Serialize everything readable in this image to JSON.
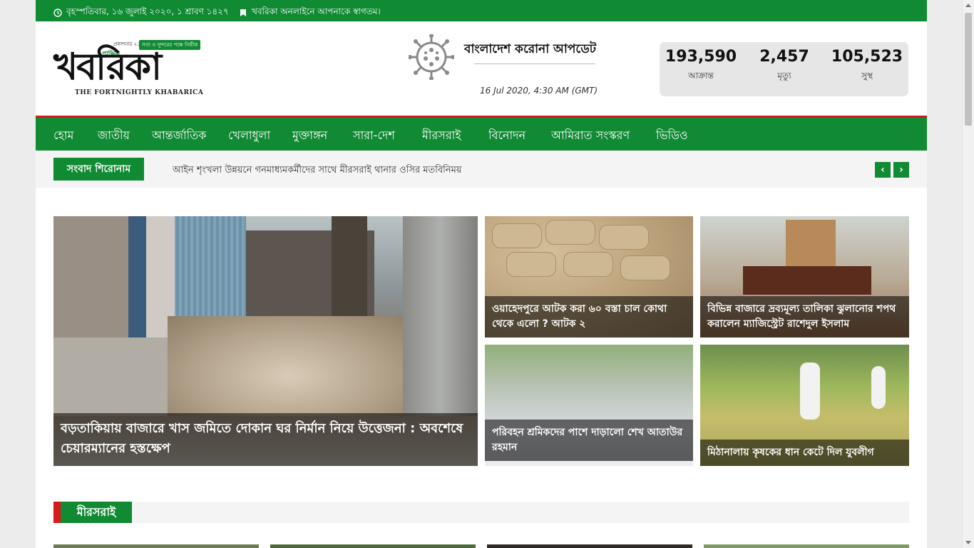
{
  "topbar": {
    "date": "বৃহস্পতিবার, ১৬ জুলাই ২০২০, ১ শ্রাবণ ১৪২৭",
    "welcome": "খবরিকা অনলাইনে আপনাকে স্বাগতম।"
  },
  "logo": {
    "brand": "খবরিকা",
    "paksik": "পাক্ষিক",
    "year": "প্রকাশনার ২১ বছর",
    "tagline": "সত্য ও সুন্দরের পক্ষে নির্ভীক",
    "english": "THE FORTNIGHTLY KHABARICA"
  },
  "corona": {
    "title": "বাংলাদেশ করোনা আপডেট",
    "date": "16 Jul 2020, 4:30 AM (GMT)"
  },
  "stats": [
    {
      "value": "193,590",
      "label": "আক্রান্ত"
    },
    {
      "value": "2,457",
      "label": "মৃত্যু"
    },
    {
      "value": "105,523",
      "label": "সুস্থ"
    }
  ],
  "nav": [
    {
      "label": "হোম",
      "active": true
    },
    {
      "label": "জাতীয়"
    },
    {
      "label": "আন্তর্জাতিক"
    },
    {
      "label": "খেলাধুলা"
    },
    {
      "label": "মুক্তাঙ্গন"
    },
    {
      "label": "সারা-দেশ"
    },
    {
      "label": "মীরসরাই"
    },
    {
      "label": "বিনোদন"
    },
    {
      "label": "আমিরাত সংস্করণ"
    },
    {
      "label": "ভিডিও"
    }
  ],
  "ticker": {
    "label": "সংবাদ শিরোনাম",
    "headline": "আইন শৃংখলা উন্নয়নে গনমাধ্যমকর্মীদের সাথে মীরসরাই থানার ওসির মতবিনিময়",
    "prev": "‹",
    "next": "›"
  },
  "news": {
    "lead": "বড়তাকিয়ায় বাজারে খাস জমিতে দোকান ঘর নির্মান নিয়ে উত্তেজনা : অবশেষে চেয়ারম্যানের হস্তক্ষেপ",
    "items": [
      "ওয়াহেদপুরে আটক করা ৬০ বস্তা চাল কোথা থেকে এলো ? আটক ২",
      "বিভিন্ন বাজারে দ্রব্যমূল্য তালিকা ঝুলানোর শপথ করালেন ম্যাজিস্ট্রেট রাশেদুল ইসলাম",
      "পরিবহন শ্রমিকদের পাশে দাড়ালো শেখ আতাউর রহমান",
      "মিঠানালায় কৃষকের ধান কেটে দিল যুবলীগ"
    ]
  },
  "section": {
    "title": "মীরসরাই"
  },
  "colors": {
    "brand_green": "#108a33",
    "accent_red": "#d71a1a"
  }
}
